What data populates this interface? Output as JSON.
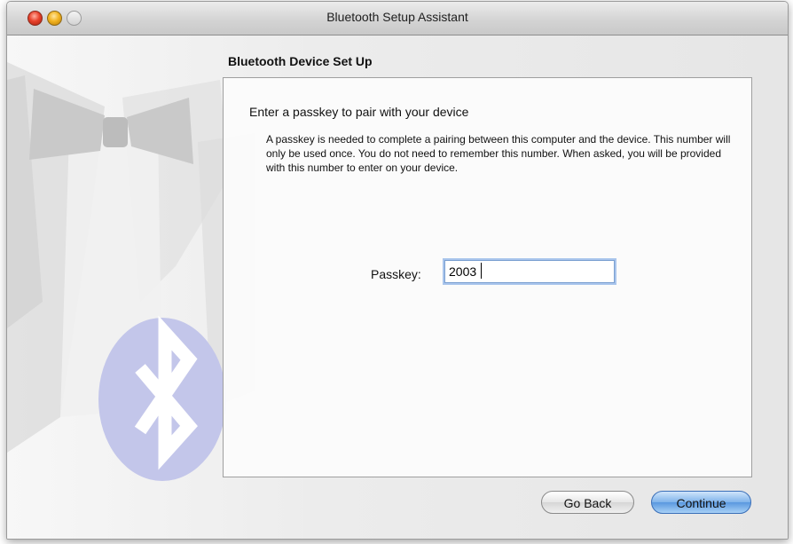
{
  "window": {
    "title": "Bluetooth Setup Assistant"
  },
  "page": {
    "heading": "Bluetooth Device Set Up"
  },
  "panel": {
    "title": "Enter a passkey to pair with your device",
    "description": "A passkey is needed to complete a pairing between this computer and the device. This number will only be used once. You do not need to remember this number. When asked, you will be provided with this number to enter on your device."
  },
  "passkey": {
    "label": "Passkey:",
    "value": "2003"
  },
  "buttons": {
    "back_label": "Go Back",
    "continue_label": "Continue"
  },
  "colors": {
    "accent": "#5a98df",
    "bluetooth_badge": "#c3c6ea"
  }
}
